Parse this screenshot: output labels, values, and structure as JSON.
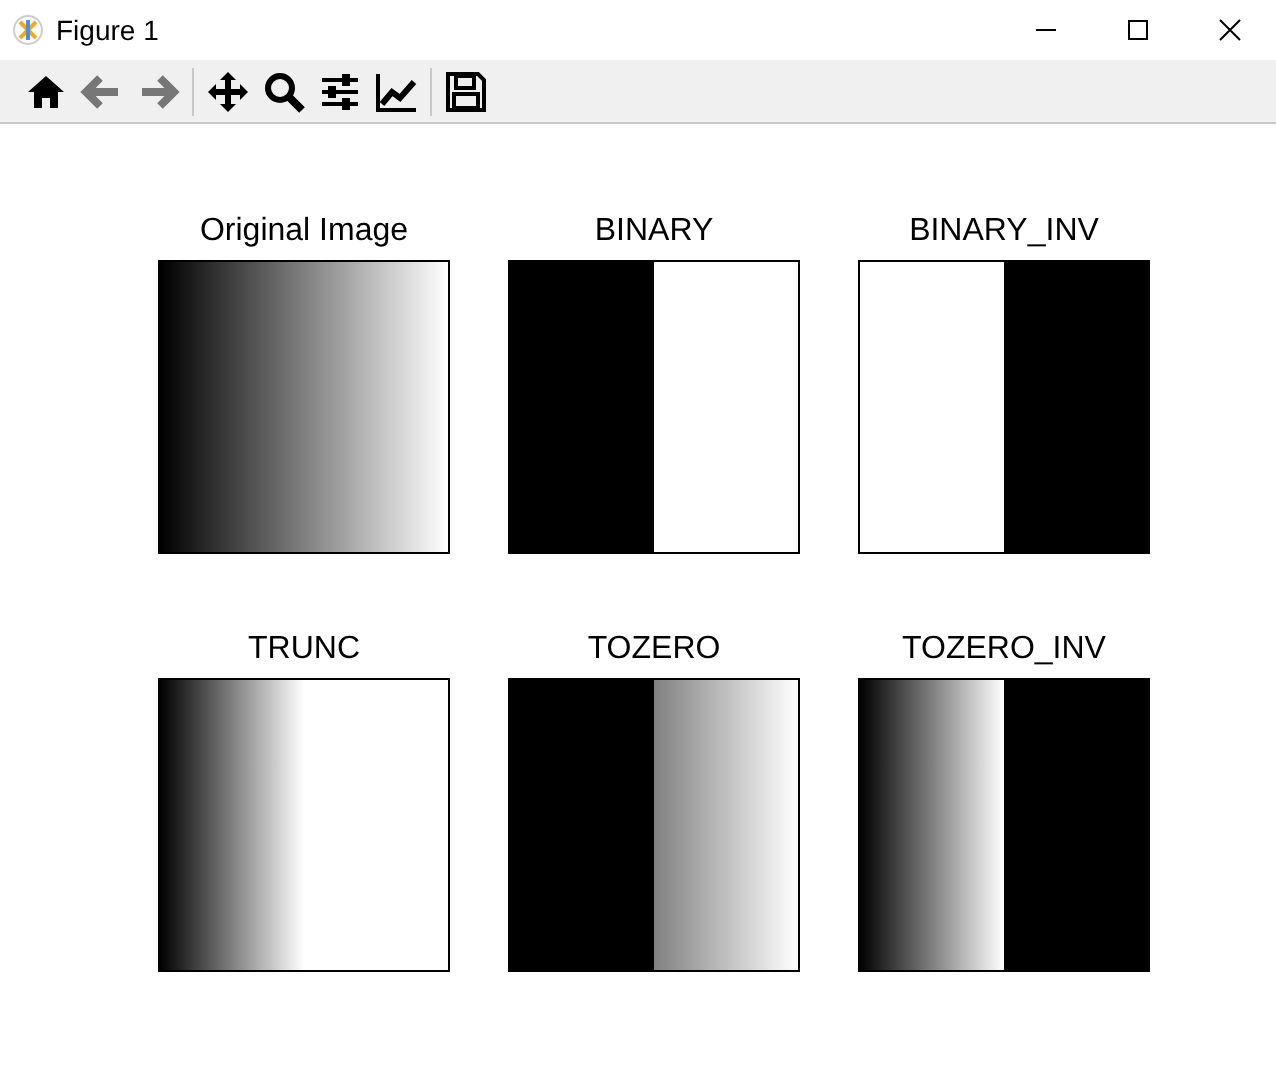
{
  "window": {
    "title": "Figure 1"
  },
  "toolbar": [
    {
      "kind": "home",
      "disabled": false
    },
    {
      "kind": "back",
      "disabled": true
    },
    {
      "kind": "forward",
      "disabled": true
    },
    {
      "kind": "separator"
    },
    {
      "kind": "pan",
      "disabled": false
    },
    {
      "kind": "zoom",
      "disabled": false
    },
    {
      "kind": "configure",
      "disabled": false
    },
    {
      "kind": "edit",
      "disabled": false
    },
    {
      "kind": "separator"
    },
    {
      "kind": "save",
      "disabled": false
    }
  ],
  "panels": [
    {
      "title": "Original Image",
      "kind": "original"
    },
    {
      "title": "BINARY",
      "kind": "binary"
    },
    {
      "title": "BINARY_INV",
      "kind": "binary_inv"
    },
    {
      "title": "TRUNC",
      "kind": "trunc"
    },
    {
      "title": "TOZERO",
      "kind": "tozero"
    },
    {
      "title": "TOZERO_INV",
      "kind": "tozero_inv"
    }
  ]
}
